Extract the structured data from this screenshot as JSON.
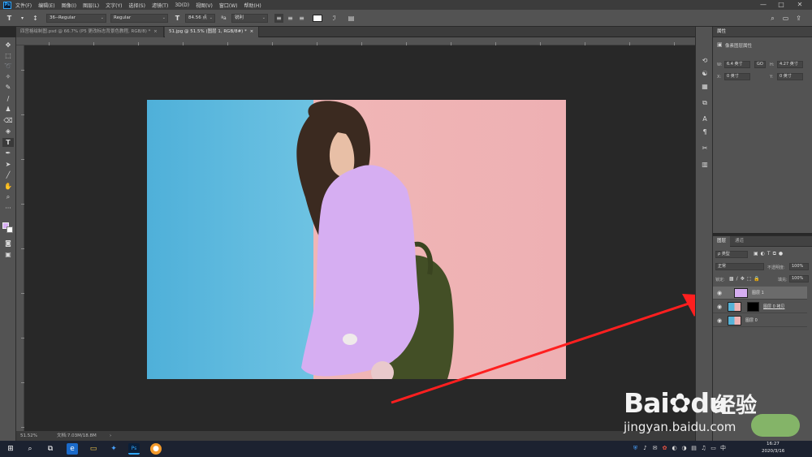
{
  "colors": {
    "accent": "#31a8ff",
    "overlay_purple": "#d6aef2",
    "photo_blue": "#57b3d8",
    "photo_pink": "#eeb3b4",
    "arrow": "#ff1f1f",
    "jacket_bag": "#434f26"
  },
  "menubar": {
    "logo": "Ps",
    "items": [
      "文件(F)",
      "编辑(E)",
      "图像(I)",
      "图层(L)",
      "文字(Y)",
      "选择(S)",
      "滤镜(T)",
      "3D(D)",
      "视图(V)",
      "窗口(W)",
      "帮助(H)"
    ],
    "minimize": "—",
    "maximize": "□",
    "close": "✕"
  },
  "options": {
    "font_family": "36--Regular",
    "font_style": "Regular",
    "font_size": "84.56 点",
    "anti_alias": "锐利"
  },
  "tabs": [
    {
      "label": "四宫格绘制图.psd @ 66.7% (P5 更改标志背景色教程, RGB/8) *",
      "close": "×"
    },
    {
      "label": "51.jpg @ 51.5% (图层 1, RGB/8#) *",
      "close": "×"
    }
  ],
  "status": {
    "zoom": "51.52%",
    "doc": "文档:7.03M/18.8M",
    "arrow": "›"
  },
  "properties": {
    "title": "属性",
    "subtitle": "像素图层属性",
    "w_label": "W:",
    "w_value": "6.4 英寸",
    "go_label": "GO",
    "h_label": "H:",
    "h_value": "4.27 英寸",
    "x_label": "X:",
    "x_value": "0 英寸",
    "y_label": "Y:",
    "y_value": "0 英寸"
  },
  "layers": {
    "tab_layers": "图层",
    "tab_channels": "通道",
    "filter_kind": "ρ 类型",
    "blend_mode": "正常",
    "opacity_label": "不透明度:",
    "opacity_value": "100%",
    "lock_label": "锁定:",
    "fill_label": "填充:",
    "fill_value": "100%",
    "items": [
      {
        "name": "图层 1"
      },
      {
        "name": "图层 0 拷贝"
      },
      {
        "name": "图层 0"
      }
    ]
  },
  "taskbar": {
    "time": "16:27",
    "date": "2020/3/16",
    "ime": "中"
  },
  "watermark": {
    "brand": "Bai",
    "brand_paw": "du",
    "jingyan": "经验",
    "url": "jingyan.baidu.com"
  }
}
